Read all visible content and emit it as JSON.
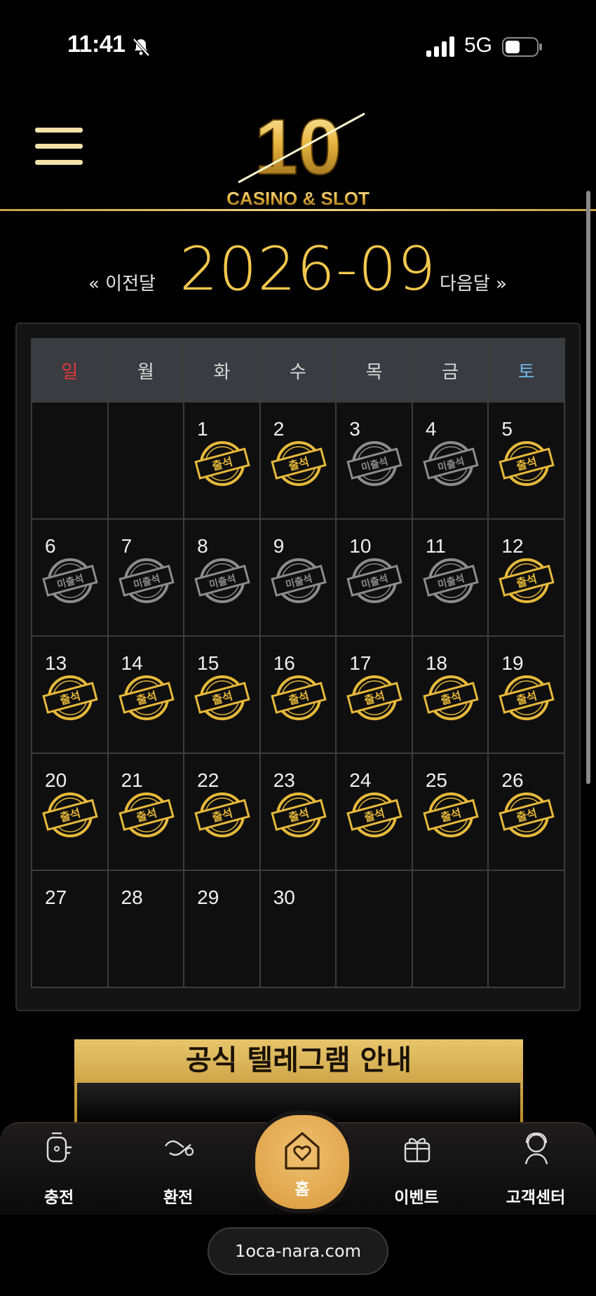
{
  "status_bar": {
    "time": "11:41",
    "network": "5G"
  },
  "logo": {
    "number": "10",
    "subtitle": "CASINO & SLOT"
  },
  "calendar": {
    "prev_label": "« 이전달",
    "month": "2026-09",
    "next_label": "다음달 »",
    "weekdays": [
      "일",
      "월",
      "화",
      "수",
      "목",
      "금",
      "토"
    ],
    "weeks": [
      [
        {
          "day": "",
          "status": ""
        },
        {
          "day": "",
          "status": ""
        },
        {
          "day": "1",
          "status": "출석"
        },
        {
          "day": "2",
          "status": "출석"
        },
        {
          "day": "3",
          "status": "미출석"
        },
        {
          "day": "4",
          "status": "미출석"
        },
        {
          "day": "5",
          "status": "출석"
        }
      ],
      [
        {
          "day": "6",
          "status": "미출석"
        },
        {
          "day": "7",
          "status": "미출석"
        },
        {
          "day": "8",
          "status": "미출석"
        },
        {
          "day": "9",
          "status": "미출석"
        },
        {
          "day": "10",
          "status": "미출석"
        },
        {
          "day": "11",
          "status": "미출석"
        },
        {
          "day": "12",
          "status": "출석"
        }
      ],
      [
        {
          "day": "13",
          "status": "출석"
        },
        {
          "day": "14",
          "status": "출석"
        },
        {
          "day": "15",
          "status": "출석"
        },
        {
          "day": "16",
          "status": "출석"
        },
        {
          "day": "17",
          "status": "출석"
        },
        {
          "day": "18",
          "status": "출석"
        },
        {
          "day": "19",
          "status": "출석"
        }
      ],
      [
        {
          "day": "20",
          "status": "출석"
        },
        {
          "day": "21",
          "status": "출석"
        },
        {
          "day": "22",
          "status": "출석"
        },
        {
          "day": "23",
          "status": "출석"
        },
        {
          "day": "24",
          "status": "출석"
        },
        {
          "day": "25",
          "status": "출석"
        },
        {
          "day": "26",
          "status": "출석"
        }
      ],
      [
        {
          "day": "27",
          "status": ""
        },
        {
          "day": "28",
          "status": ""
        },
        {
          "day": "29",
          "status": ""
        },
        {
          "day": "30",
          "status": ""
        },
        {
          "day": "",
          "status": ""
        },
        {
          "day": "",
          "status": ""
        },
        {
          "day": "",
          "status": ""
        }
      ]
    ]
  },
  "banner": {
    "title": "공식 텔레그램 안내"
  },
  "bottom_nav": [
    {
      "label": "충전",
      "icon": "charge-icon"
    },
    {
      "label": "환전",
      "icon": "exchange-icon"
    },
    {
      "label": "홈",
      "icon": "home-heart-icon"
    },
    {
      "label": "이벤트",
      "icon": "gift-icon"
    },
    {
      "label": "고객센터",
      "icon": "support-icon"
    }
  ],
  "url_bar": {
    "url": "1oca-nara.com"
  },
  "colors": {
    "gold": "#f3c84e",
    "sunday": "#e03a3a",
    "saturday": "#6fb7e6",
    "stamp_gold": "#e7b93a",
    "stamp_gray": "#8c8c8c"
  }
}
